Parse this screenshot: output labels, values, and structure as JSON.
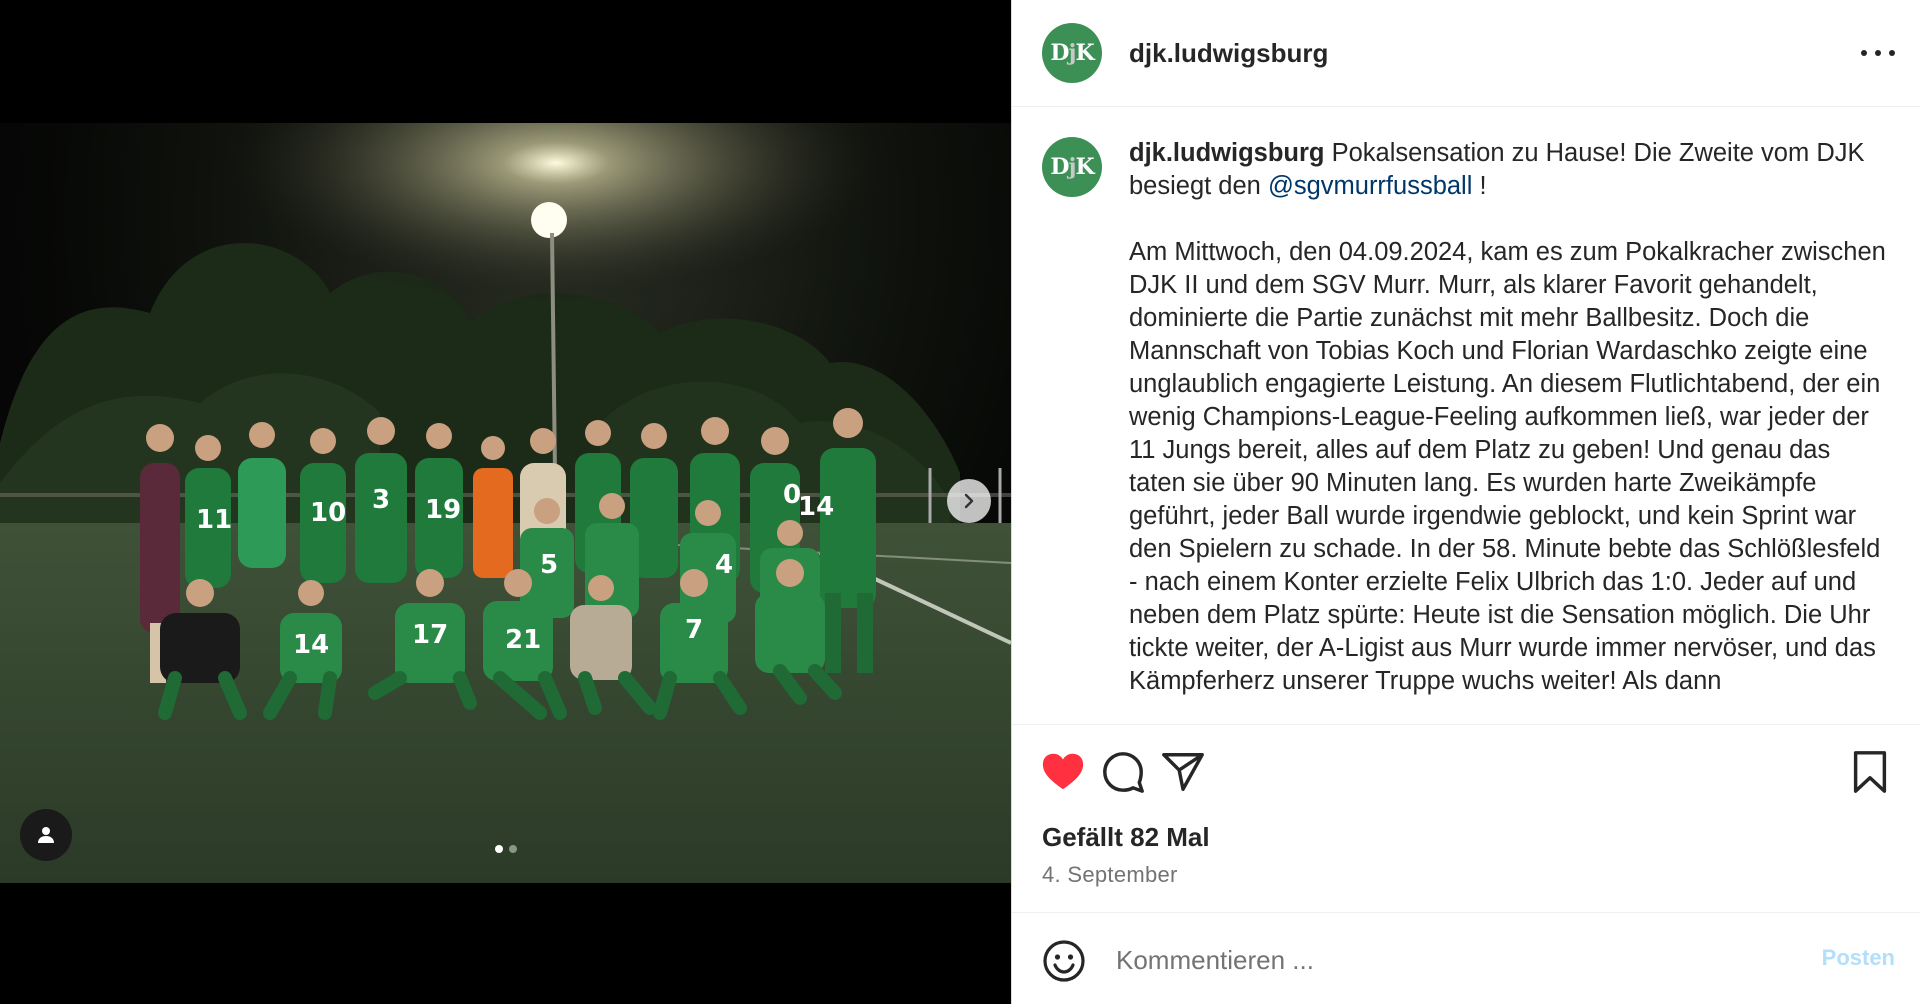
{
  "account": {
    "username": "djk.ludwigsburg",
    "avatar_text": "DjK"
  },
  "media": {
    "alt_subject": "team photo",
    "carousel_count": 2,
    "carousel_index": 1,
    "next_icon": "chevron-right-icon",
    "tag_icon": "user-icon"
  },
  "caption": {
    "username": "djk.ludwigsburg",
    "headline": "Pokalsensation zu Hause! Die Zweite vom DJK besiegt den ",
    "mention": "@sgvmurrfussball",
    "headline_end": " !",
    "body": "Am Mittwoch, den 04.09.2024, kam es zum Pokalkracher zwischen DJK II und dem SGV Murr. Murr, als klarer Favorit gehandelt, dominierte die Partie zunächst mit mehr Ballbesitz. Doch die Mannschaft von Tobias Koch und Florian Wardaschko zeigte eine unglaublich engagierte Leistung. An diesem Flutlichtabend, der ein wenig Champions-League-Feeling aufkommen ließ, war jeder der 11 Jungs bereit, alles auf dem Platz zu geben! Und genau das taten sie über 90 Minuten lang. Es wurden harte Zweikämpfe geführt, jeder Ball wurde irgendwie geblockt, und kein Sprint war den Spielern zu schade. In der 58. Minute bebte das Schlößlesfeld - nach einem Konter erzielte Felix Ulbrich das 1:0. Jeder auf und neben dem Platz spürte: Heute ist die Sensation möglich. Die Uhr tickte weiter, der A-Ligist aus Murr wurde immer nervöser, und das Kämpferherz unserer Truppe wuchs weiter! Als dann"
  },
  "actions": {
    "like_icon": "heart-filled-icon",
    "comment_icon": "comment-icon",
    "share_icon": "send-icon",
    "save_icon": "bookmark-icon"
  },
  "stats": {
    "likes_text": "Gefällt 82 Mal",
    "date_text": "4. September"
  },
  "comment": {
    "placeholder": "Kommentieren ...",
    "post_label": "Posten",
    "emoji_icon": "emoji-icon"
  },
  "colors": {
    "like_red": "#ff3040",
    "mention_blue": "#00376b",
    "post_disabled": "#b2dffc",
    "avatar_green": "#3c8f55"
  }
}
